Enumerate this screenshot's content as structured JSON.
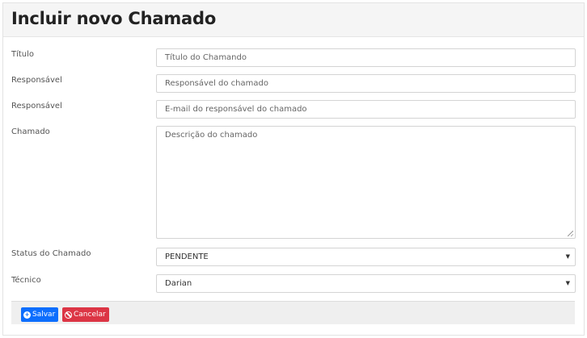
{
  "header": {
    "title": "Incluir novo Chamado"
  },
  "form": {
    "titulo": {
      "label": "Título",
      "placeholder": "Título do Chamando"
    },
    "responsavel": {
      "label": "Responsável",
      "placeholder": "Responsável do chamado"
    },
    "email": {
      "label": "Responsável",
      "placeholder": "E-mail do responsável do chamado"
    },
    "chamado": {
      "label": "Chamado",
      "placeholder": "Descrição do chamado"
    },
    "status": {
      "label": "Status do Chamado",
      "value": "PENDENTE"
    },
    "tecnico": {
      "label": "Técnico",
      "value": "Darian"
    }
  },
  "footer": {
    "save_label": "Salvar",
    "cancel_label": "Cancelar"
  },
  "icons": {
    "save": "plus-circle-icon",
    "cancel": "ban-icon",
    "select_caret": "caret-down-icon"
  },
  "colors": {
    "save": "#0d6efd",
    "cancel": "#dc3545"
  }
}
